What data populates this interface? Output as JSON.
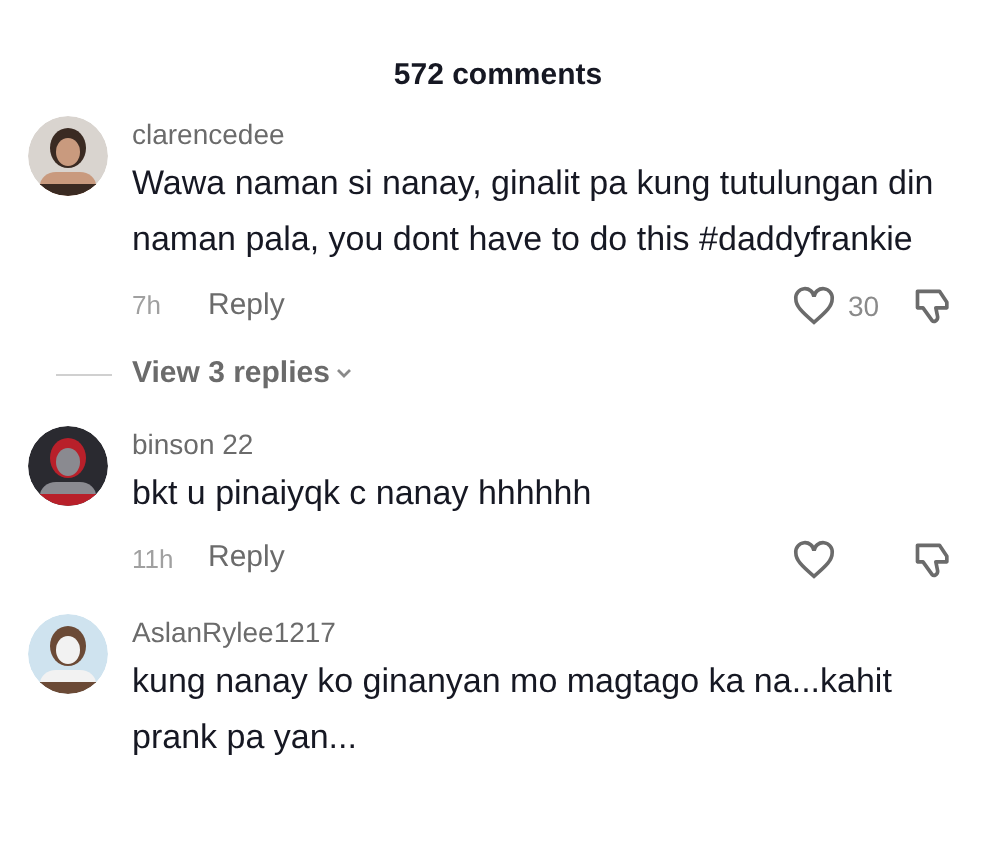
{
  "header": {
    "title": "572 comments"
  },
  "comments": [
    {
      "username": "clarencedee",
      "text": "Wawa naman si nanay, ginalit pa kung tutulungan din naman pala, you dont have to do this #daddyfrankie",
      "time": "7h",
      "reply": "Reply",
      "likes": "30",
      "view_replies": "View 3 replies"
    },
    {
      "username": "binson 22",
      "text": "bkt u pinaiyqk c nanay hhhhhh",
      "time": "11h",
      "reply": "Reply"
    },
    {
      "username": "AslanRylee1217",
      "text": "kung nanay ko ginanyan mo magtago ka na...kahit prank pa yan..."
    }
  ]
}
